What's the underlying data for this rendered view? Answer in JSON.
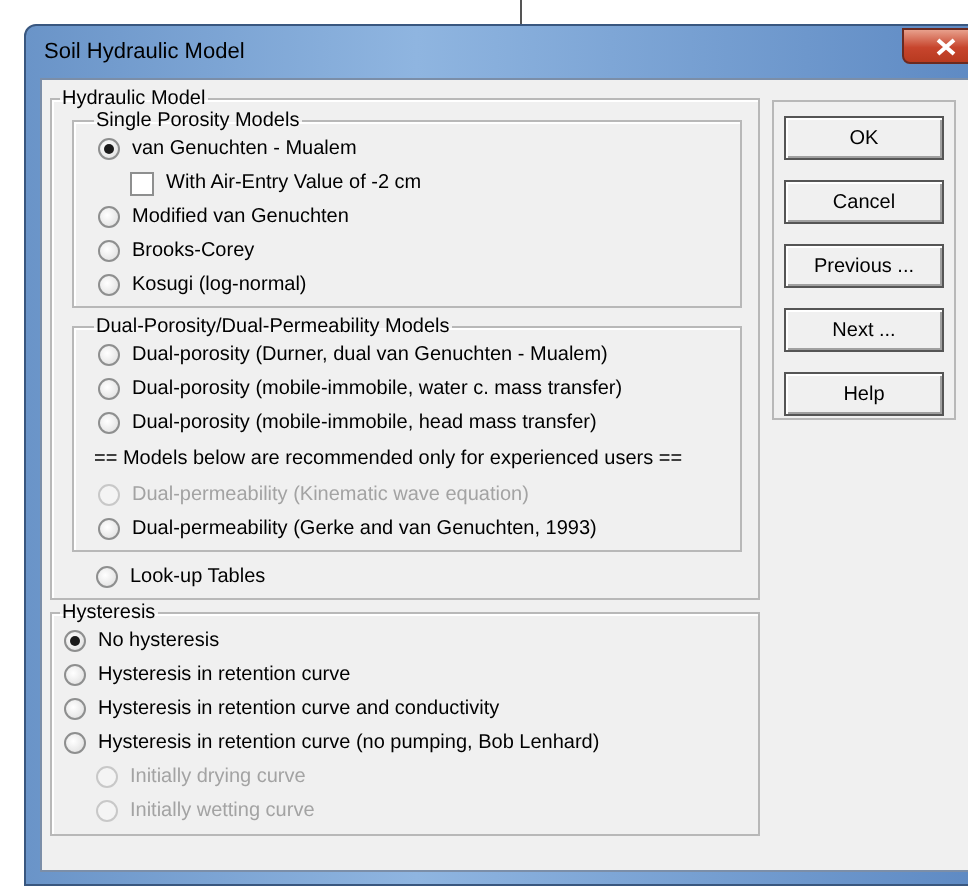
{
  "window": {
    "title": "Soil Hydraulic Model"
  },
  "hydraulic_model": {
    "label": "Hydraulic Model",
    "single_porosity": {
      "label": "Single Porosity Models",
      "options": [
        {
          "kind": "radio",
          "label": "van Genuchten - Mualem",
          "selected": true,
          "disabled": false,
          "children": [
            {
              "kind": "checkbox",
              "label": "With Air-Entry Value of -2 cm",
              "checked": false,
              "disabled": false
            }
          ]
        },
        {
          "kind": "radio",
          "label": "Modified van Genuchten",
          "selected": false,
          "disabled": false
        },
        {
          "kind": "radio",
          "label": "Brooks-Corey",
          "selected": false,
          "disabled": false
        },
        {
          "kind": "radio",
          "label": "Kosugi (log-normal)",
          "selected": false,
          "disabled": false
        }
      ]
    },
    "dual_porosity": {
      "label": "Dual-Porosity/Dual-Permeability Models",
      "options": [
        {
          "kind": "radio",
          "label": "Dual-porosity (Durner, dual van Genuchten - Mualem)",
          "selected": false,
          "disabled": false
        },
        {
          "kind": "radio",
          "label": "Dual-porosity (mobile-immobile, water c. mass transfer)",
          "selected": false,
          "disabled": false
        },
        {
          "kind": "radio",
          "label": "Dual-porosity (mobile-immobile, head mass transfer)",
          "selected": false,
          "disabled": false
        },
        {
          "kind": "note",
          "label": "== Models below are recommended only for experienced users =="
        },
        {
          "kind": "radio",
          "label": "Dual-permeability (Kinematic wave equation)",
          "selected": false,
          "disabled": true
        },
        {
          "kind": "radio",
          "label": "Dual-permeability (Gerke and van Genuchten, 1993)",
          "selected": false,
          "disabled": false
        }
      ]
    },
    "options": [
      {
        "kind": "radio",
        "label": "Look-up Tables",
        "selected": false,
        "disabled": false
      }
    ]
  },
  "hysteresis": {
    "label": "Hysteresis",
    "options": [
      {
        "kind": "radio",
        "label": "No hysteresis",
        "selected": true,
        "disabled": false
      },
      {
        "kind": "radio",
        "label": "Hysteresis in retention curve",
        "selected": false,
        "disabled": false
      },
      {
        "kind": "radio",
        "label": "Hysteresis in retention curve and conductivity",
        "selected": false,
        "disabled": false
      },
      {
        "kind": "radio",
        "label": "Hysteresis in retention curve (no pumping, Bob Lenhard)",
        "selected": false,
        "disabled": false,
        "children": [
          {
            "kind": "radio",
            "label": "Initially drying curve",
            "selected": false,
            "disabled": true
          },
          {
            "kind": "radio",
            "label": "Initially wetting curve",
            "selected": false,
            "disabled": true
          }
        ]
      }
    ]
  },
  "buttons": [
    "OK",
    "Cancel",
    "Previous ...",
    "Next ...",
    "Help"
  ]
}
